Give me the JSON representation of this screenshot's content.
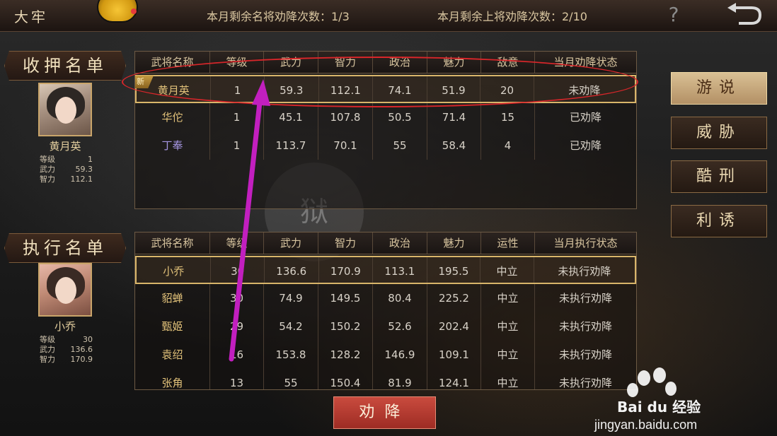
{
  "header": {
    "title": "大牢",
    "counter_famous": "本月剩余名将劝降次数：1/3",
    "counter_upper": "本月剩余上将劝降次数：2/10",
    "help_glyph": "?"
  },
  "detention": {
    "label": "收押名单",
    "selected": {
      "name": "黄月英",
      "stats": [
        {
          "label": "等级",
          "value": "1"
        },
        {
          "label": "武力",
          "value": "59.3"
        },
        {
          "label": "智力",
          "value": "112.1"
        }
      ]
    },
    "headers": [
      "武将名称",
      "等级",
      "武力",
      "智力",
      "政治",
      "魅力",
      "敌意",
      "当月劝降状态"
    ],
    "rows": [
      {
        "name": "黄月英",
        "badge": "新",
        "level": "1",
        "str": "59.3",
        "int": "112.1",
        "pol": "74.1",
        "cha": "51.9",
        "hostility": "20",
        "status": "未劝降"
      },
      {
        "name": "华佗",
        "level": "1",
        "str": "45.1",
        "int": "107.8",
        "pol": "50.5",
        "cha": "71.4",
        "hostility": "15",
        "status": "已劝降"
      },
      {
        "name": "丁奉",
        "level": "1",
        "str": "113.7",
        "int": "70.1",
        "pol": "55",
        "cha": "58.4",
        "hostility": "4",
        "status": "已劝降"
      }
    ]
  },
  "execution": {
    "label": "执行名单",
    "selected": {
      "name": "小乔",
      "stats": [
        {
          "label": "等级",
          "value": "30"
        },
        {
          "label": "武力",
          "value": "136.6"
        },
        {
          "label": "智力",
          "value": "170.9"
        }
      ]
    },
    "headers": [
      "武将名称",
      "等级",
      "武力",
      "智力",
      "政治",
      "魅力",
      "运性",
      "当月执行状态"
    ],
    "rows": [
      {
        "name": "小乔",
        "level": "30",
        "str": "136.6",
        "int": "170.9",
        "pol": "113.1",
        "cha": "195.5",
        "trait": "中立",
        "status": "未执行劝降"
      },
      {
        "name": "貂蝉",
        "level": "30",
        "str": "74.9",
        "int": "149.5",
        "pol": "80.4",
        "cha": "225.2",
        "trait": "中立",
        "status": "未执行劝降"
      },
      {
        "name": "甄姬",
        "level": "29",
        "str": "54.2",
        "int": "150.2",
        "pol": "52.6",
        "cha": "202.4",
        "trait": "中立",
        "status": "未执行劝降"
      },
      {
        "name": "袁绍",
        "level": "16",
        "str": "153.8",
        "int": "128.2",
        "pol": "146.9",
        "cha": "109.1",
        "trait": "中立",
        "status": "未执行劝降"
      },
      {
        "name": "张角",
        "level": "13",
        "str": "55",
        "int": "150.4",
        "pol": "81.9",
        "cha": "124.1",
        "trait": "中立",
        "status": "未执行劝降"
      }
    ]
  },
  "actions": {
    "persuade": "游说",
    "threaten": "威胁",
    "torture": "酷刑",
    "lure": "利诱",
    "main": "劝降"
  },
  "background_seal": "狱",
  "watermark": {
    "brand": "Bai du 经验",
    "url": "jingyan.baidu.com"
  },
  "colors": {
    "highlight_border": "#d8b56a",
    "annotation_red": "#d8262a",
    "annotation_arrow": "#c21fbf",
    "main_button": "#b8382e"
  }
}
